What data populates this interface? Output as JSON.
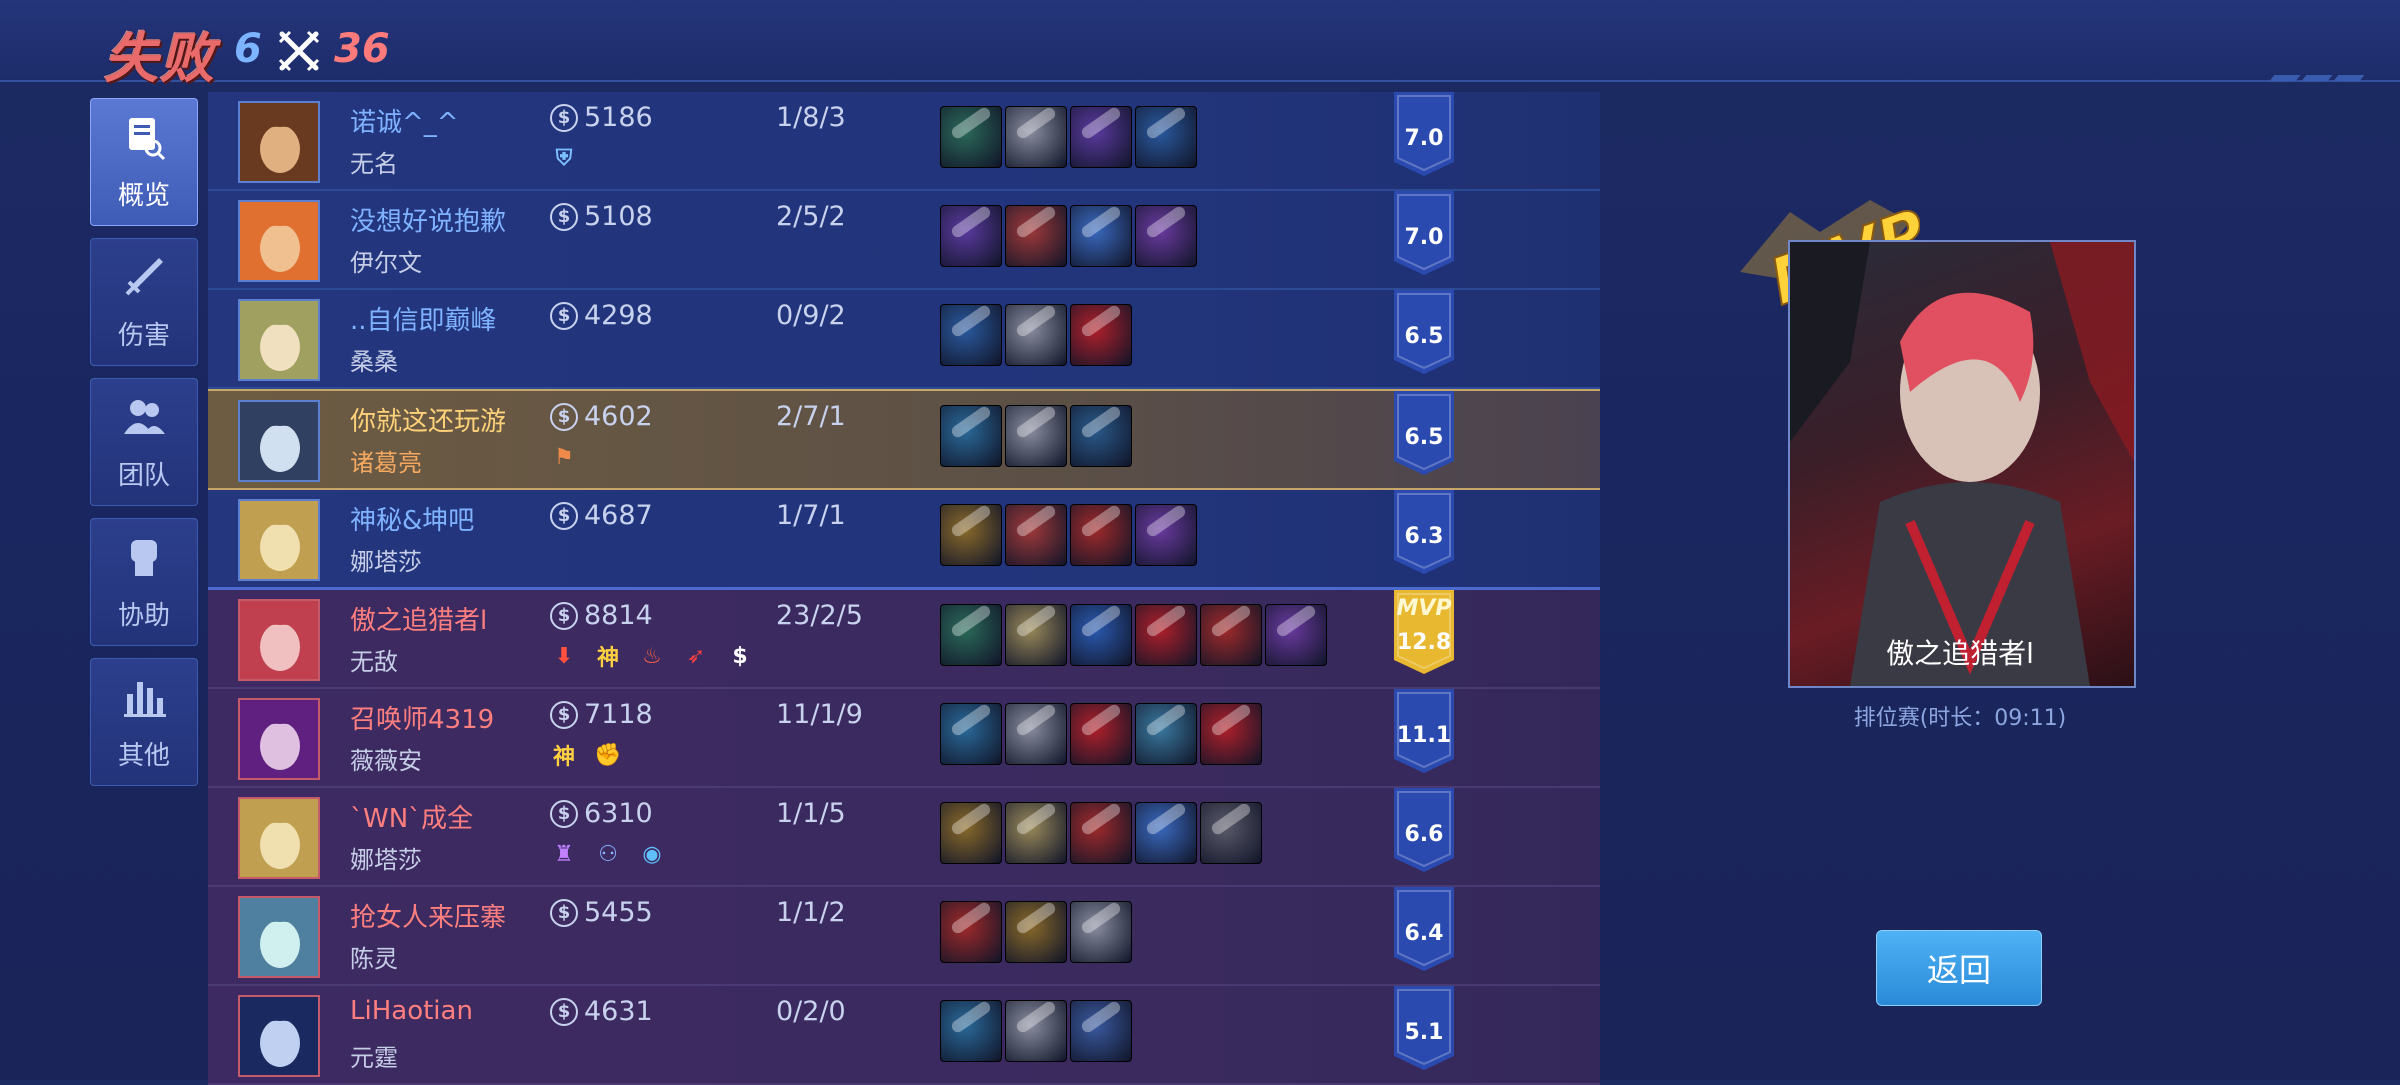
{
  "header": {
    "result": "失败",
    "score_blue": "6",
    "score_red": "36"
  },
  "nav": [
    {
      "label": "概览",
      "icon": "overview-icon",
      "active": true
    },
    {
      "label": "伤害",
      "icon": "sword-icon",
      "active": false
    },
    {
      "label": "团队",
      "icon": "team-icon",
      "active": false
    },
    {
      "label": "协助",
      "icon": "fist-icon",
      "active": false
    },
    {
      "label": "其他",
      "icon": "bar-chart-icon",
      "active": false
    }
  ],
  "players": [
    {
      "team": "blue",
      "name": "诺诚^_^",
      "hero": "无名",
      "gold": "5186",
      "kda": "1/8/3",
      "rating": "7.0",
      "badges": [
        {
          "t": "shield",
          "c": "#7cc0ff",
          "g": "⛨"
        }
      ],
      "items": [
        "#2b6a5a",
        "#8a8ea0",
        "#5b3aa0",
        "#2a5aa0"
      ]
    },
    {
      "team": "blue",
      "name": "没想好说抱歉",
      "hero": "伊尔文",
      "gold": "5108",
      "kda": "2/5/2",
      "rating": "7.0",
      "badges": [],
      "items": [
        "#5b3aa0",
        "#a03a3a",
        "#3a6ac0",
        "#6a3aa0"
      ]
    },
    {
      "team": "blue",
      "name": "..自信即巅峰",
      "hero": "桑桑",
      "gold": "4298",
      "kda": "0/9/2",
      "rating": "6.5",
      "badges": [],
      "items": [
        "#2a5aa0",
        "#8a8ea0",
        "#b0202a"
      ]
    },
    {
      "team": "blue",
      "self": true,
      "name": "你就这还玩游",
      "hero": "诸葛亮",
      "gold": "4602",
      "kda": "2/7/1",
      "rating": "6.5",
      "badges": [
        {
          "t": "flag",
          "c": "#f08a4a",
          "g": "⚑"
        }
      ],
      "items": [
        "#2a6a9a",
        "#8a8ea0",
        "#2a5a8a"
      ]
    },
    {
      "team": "blue",
      "split": true,
      "name": "神秘&坤吧",
      "hero": "娜塔莎",
      "gold": "4687",
      "kda": "1/7/1",
      "rating": "6.3",
      "badges": [],
      "items": [
        "#8a6a2a",
        "#a03a3a",
        "#a02a2a",
        "#6a3aa0"
      ]
    },
    {
      "team": "red",
      "name": "傲之追猎者l",
      "hero": "无敌",
      "gold": "8814",
      "kda": "23/2/5",
      "rating": "12.8",
      "mvp": true,
      "badges": [
        {
          "t": "down",
          "c": "#ff5040",
          "g": "⬇"
        },
        {
          "t": "god",
          "c": "#ffd040",
          "g": "神"
        },
        {
          "t": "fire",
          "c": "#ff6040",
          "g": "♨"
        },
        {
          "t": "flame",
          "c": "#ff4040",
          "g": "➶"
        },
        {
          "t": "coin",
          "c": "#ffffff",
          "g": "$"
        }
      ],
      "items": [
        "#2b6a5a",
        "#9a8a5a",
        "#2a5ab0",
        "#b0202a",
        "#a02a2a",
        "#6a3aa0"
      ]
    },
    {
      "team": "red",
      "name": "召唤师4319",
      "hero": "薇薇安",
      "gold": "7118",
      "kda": "11/1/9",
      "rating": "11.1",
      "badges": [
        {
          "t": "god",
          "c": "#ffd040",
          "g": "神"
        },
        {
          "t": "fist",
          "c": "#60e060",
          "g": "✊"
        }
      ],
      "items": [
        "#2a6a9a",
        "#8a8ea0",
        "#b0202a",
        "#3a7aa0",
        "#b0202a"
      ]
    },
    {
      "team": "red",
      "name": "`WN`成全",
      "hero": "娜塔莎",
      "gold": "6310",
      "kda": "1/1/5",
      "rating": "6.6",
      "badges": [
        {
          "t": "tower",
          "c": "#c080ff",
          "g": "♜"
        },
        {
          "t": "hood",
          "c": "#8ab0ff",
          "g": "⚇"
        },
        {
          "t": "eye",
          "c": "#60c0ff",
          "g": "◉"
        }
      ],
      "items": [
        "#8a6a2a",
        "#9a8a5a",
        "#a02a2a",
        "#3a6ac0",
        "#5a5a6a"
      ]
    },
    {
      "team": "red",
      "name": "抢女人来压寨",
      "hero": "陈灵",
      "gold": "5455",
      "kda": "1/1/2",
      "rating": "6.4",
      "badges": [],
      "items": [
        "#a02a2a",
        "#8a6a2a",
        "#8a8ea0"
      ]
    },
    {
      "team": "red",
      "name": "LiHaotian",
      "hero": "元霆",
      "gold": "4631",
      "kda": "0/2/0",
      "rating": "5.1",
      "badges": [],
      "items": [
        "#2a6a9a",
        "#8a8ea0",
        "#3a5aa0"
      ]
    }
  ],
  "mvp": {
    "badge": "MVP",
    "name": "傲之追猎者l",
    "match_info": "排位赛(时长：09:11)"
  },
  "buttons": {
    "back": "返回"
  },
  "colors": {
    "blue_team": "#7fb2ff",
    "red_team": "#ff7f7f",
    "self": "#ffd27a",
    "gold_badge": "#e8b830",
    "blue_badge": "#2a4ab0"
  }
}
